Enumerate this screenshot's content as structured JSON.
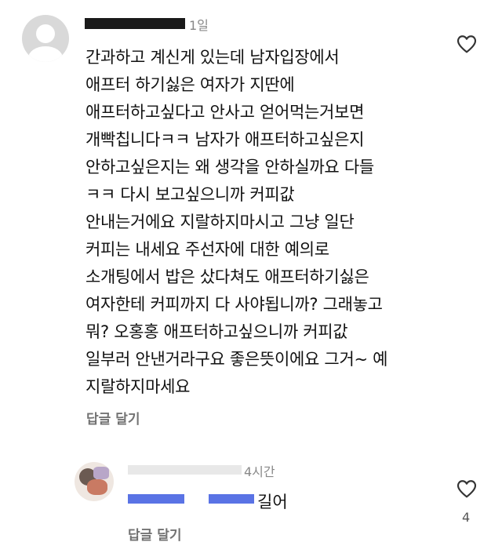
{
  "comment": {
    "time": "1일",
    "lines": [
      "간과하고 계신게 있는데 남자입장에서",
      "애프터 하기싫은 여자가 지딴에",
      "애프터하고싶다고 안사고 얻어먹는거보면",
      "개빡칩니다ㅋㅋ 남자가 애프터하고싶은지",
      "안하고싶은지는 왜 생각을 안하실까요 다들",
      "ㅋㅋ 다시 보고싶으니까 커피값",
      "안내는거에요 지랄하지마시고 그냥 일단",
      "커피는 내세요 주선자에 대한 예의로",
      "소개팅에서 밥은 샀다쳐도 애프터하기싫은",
      "여자한테 커피까지 다 사야됩니까? 그래놓고",
      "뭐? 오홍홍 애프터하고싶으니까 커피값",
      "일부러 안낸거라구요 좋은뜻이에요 그거~ 예",
      "지랄하지마세요"
    ],
    "reply_link": "답글 달기",
    "heart_icon": "heart-outline-icon"
  },
  "reply": {
    "time": "4시간",
    "text": "길어",
    "reply_link": "답글 달기",
    "likes": "4",
    "heart_icon": "heart-outline-icon"
  }
}
